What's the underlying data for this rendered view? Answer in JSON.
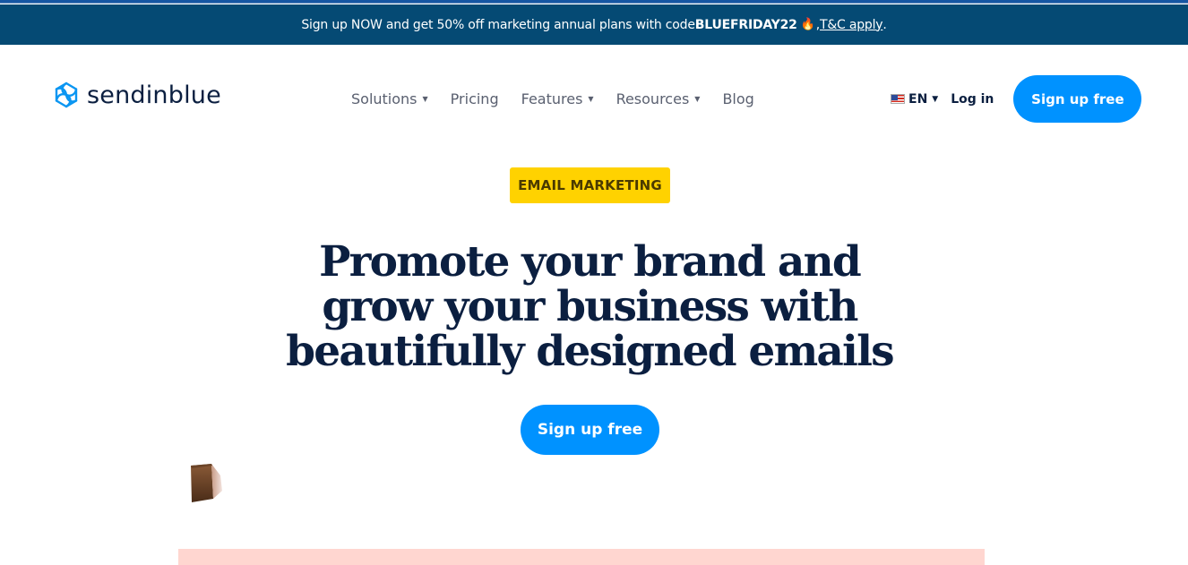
{
  "promo_banner": {
    "text_before": "Sign up NOW and get 50% off marketing annual plans with code ",
    "code": "BLUEFRIDAY22",
    "emoji": "🔥",
    "separator": ", ",
    "link_label": "T&C apply",
    "text_after": "."
  },
  "header": {
    "logo_text": "sendinblue",
    "nav": [
      {
        "label": "Solutions",
        "has_dropdown": true
      },
      {
        "label": "Pricing",
        "has_dropdown": false
      },
      {
        "label": "Features",
        "has_dropdown": true
      },
      {
        "label": "Resources",
        "has_dropdown": true
      },
      {
        "label": "Blog",
        "has_dropdown": false
      }
    ],
    "caret_glyph": "▼",
    "language": {
      "code": "EN",
      "flag": "us-flag-icon"
    },
    "login_label": "Log in",
    "signup_label": "Sign up free"
  },
  "hero": {
    "badge": "EMAIL MARKETING",
    "headline_lines": [
      "Promote your brand and",
      "grow your business with",
      "beautifully designed emails"
    ],
    "cta_label": "Sign up free"
  },
  "colors": {
    "promo_bg": "#054a74",
    "brand_blue": "#0092ff",
    "navy_text": "#0b1f40",
    "badge_yellow": "#ffd200",
    "pink_panel": "#ffd6d0"
  }
}
